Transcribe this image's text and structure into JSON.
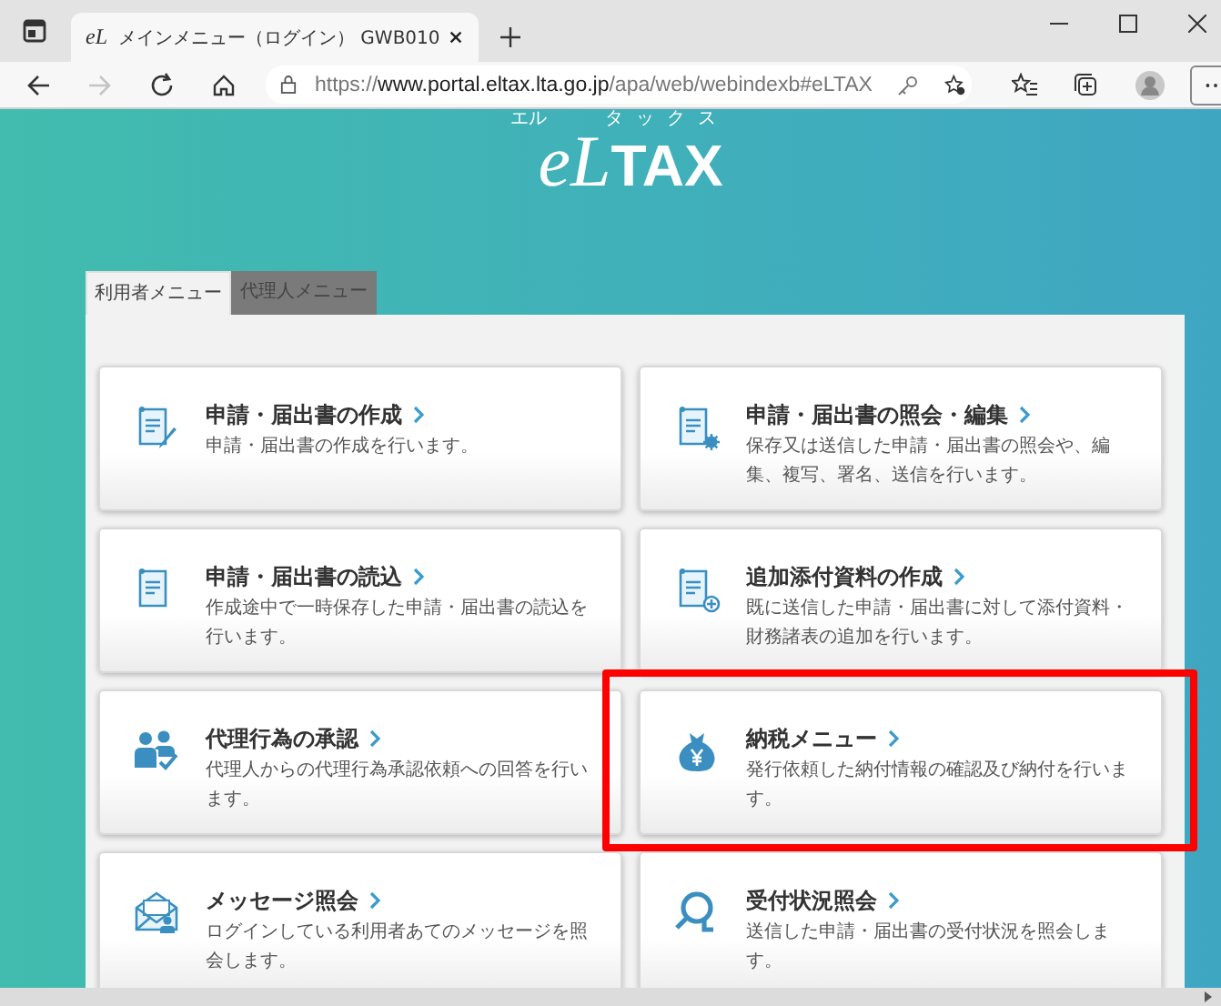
{
  "browser": {
    "tab": {
      "favicon": "eL",
      "title": "メインメニュー（ログイン） GWB010"
    },
    "forward_disabled": true,
    "address": {
      "scheme": "https://",
      "host": "www.portal.eltax.lta.go.jp",
      "path": "/apa/web/webindexb#eLTAX"
    }
  },
  "logo": {
    "reading_left": "エル",
    "reading_right": "タックス",
    "mark": "eL",
    "word": "TAX"
  },
  "menu_tabs": [
    {
      "label": "利用者メニュー",
      "selected": true
    },
    {
      "label": "代理人メニュー",
      "selected": false
    }
  ],
  "cards": [
    {
      "kind": "pencil",
      "title": "申請・届出書の作成",
      "description": "申請・届出書の作成を行います。",
      "highlighted": false
    },
    {
      "kind": "gear",
      "title": "申請・届出書の照会・編集",
      "description": "保存又は送信した申請・届出書の照会や、編集、複写、署名、送信を行います。",
      "highlighted": false
    },
    {
      "kind": "document",
      "title": "申請・届出書の読込",
      "description": "作成途中で一時保存した申請・届出書の読込を行います。",
      "highlighted": false
    },
    {
      "kind": "plus",
      "title": "追加添付資料の作成",
      "description": "既に送信した申請・届出書に対して添付資料・財務諸表の追加を行います。",
      "highlighted": false
    },
    {
      "kind": "people",
      "title": "代理行為の承認",
      "description": "代理人からの代理行為承認依頼への回答を行います。",
      "highlighted": false
    },
    {
      "kind": "bag",
      "title": "納税メニュー",
      "description": "発行依頼した納付情報の確認及び納付を行います。",
      "highlighted": true
    },
    {
      "kind": "envelope",
      "title": "メッセージ照会",
      "description": "ログインしている利用者あてのメッセージを照会します。",
      "highlighted": false
    },
    {
      "kind": "magnifier",
      "title": "受付状況照会",
      "description": "送信した申請・届出書の受付状況を照会します。",
      "highlighted": false
    }
  ]
}
